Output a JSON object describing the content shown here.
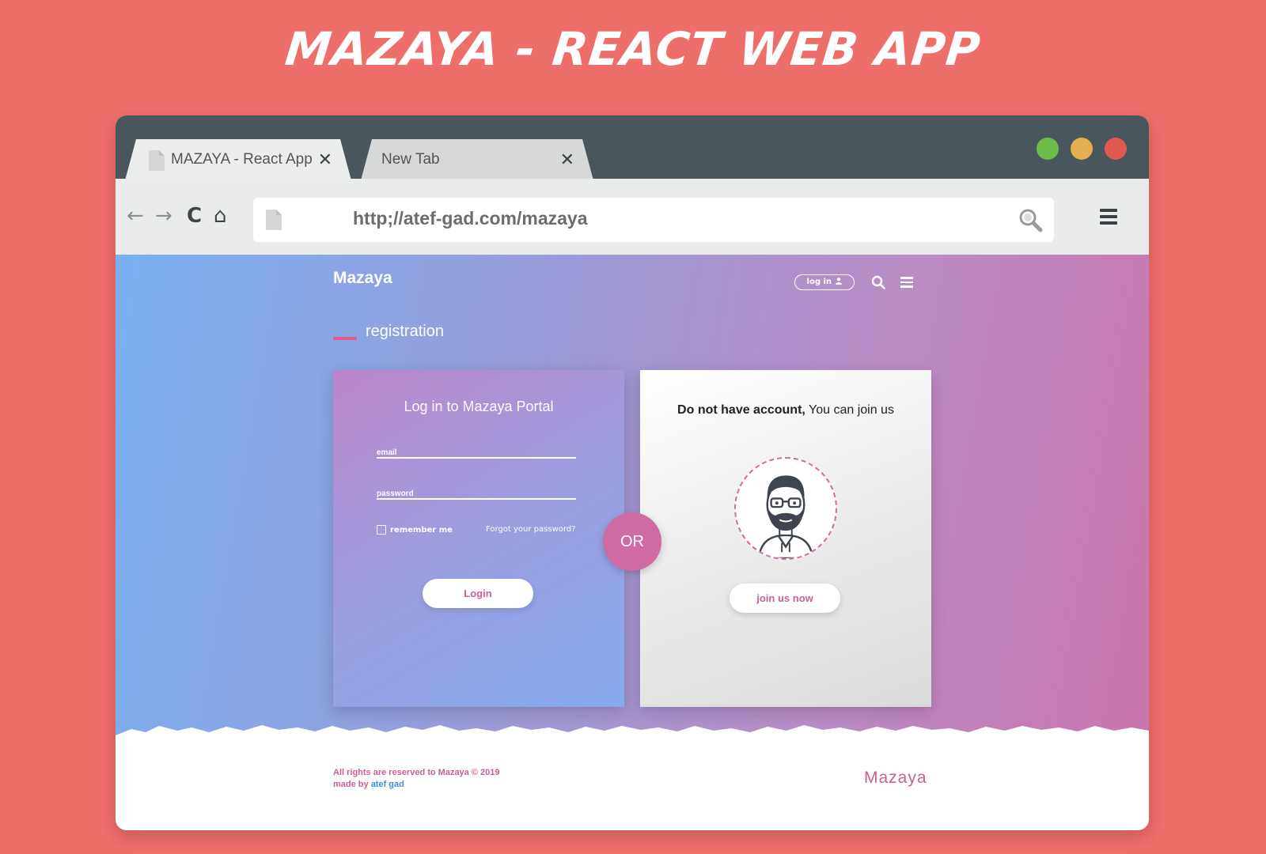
{
  "banner": {
    "title": "Mazaya - React Web App"
  },
  "browser": {
    "tabs": [
      {
        "title": "MAZAYA - React App",
        "close": "✕"
      },
      {
        "title": "New Tab",
        "close": "✕"
      }
    ],
    "window_controls": [
      "green",
      "yellow",
      "red"
    ],
    "url": "http;//atef-gad.com/mazaya",
    "nav_icons": {
      "back": "←",
      "forward": "→",
      "reload": "C",
      "home": "⌂"
    }
  },
  "site": {
    "logo": "Mazaya",
    "nav": {
      "login_label": "log in"
    },
    "section_title": "registration",
    "login_card": {
      "title": "Log in to Mazaya Portal",
      "email_placeholder": "email",
      "password_placeholder": "password",
      "remember_label": "remember me",
      "forgot_label": "Forgot your password?",
      "login_button": "Login"
    },
    "or_label": "OR",
    "join_card": {
      "text_bold": "Do not have account,",
      "text_rest": " You can join us",
      "join_button": "join us now"
    },
    "footer": {
      "copyright": "All rights are reserved to Mazaya © 2019",
      "made_by": "made by ",
      "author": "atef gad",
      "logo": "Mazaya"
    }
  },
  "colors": {
    "page_bg": "#ee6e6a",
    "titlebar": "#49565c",
    "accent_pink": "#c85f98",
    "link_blue": "#3d8ee0"
  }
}
